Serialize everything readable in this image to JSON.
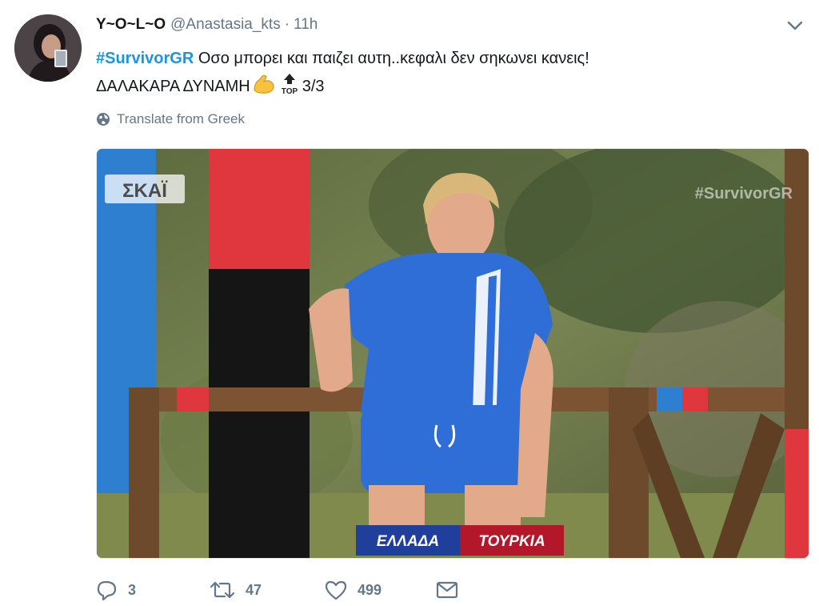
{
  "tweet": {
    "display_name": "Y~O~L~O",
    "handle": "@Anastasia_kts",
    "separator": "·",
    "time": "11h",
    "hashtag": "#SurvivorGR",
    "text_line1": " Οσο μπορει και παιζει αυτη..κεφαλι δεν σηκωνει κανεις!",
    "text_line2": "ΔΑΛΑΚΑΡΑ ΔΥΝΑΜΗ",
    "text_line2_suffix": "3/3",
    "emojis": [
      "flexed-biceps",
      "top-arrow"
    ],
    "top_badge_text": "TOP",
    "translate_label": "Translate from Greek"
  },
  "media": {
    "channel_logo": "ΣΚΑΪ",
    "watermark": "#SurvivorGR",
    "scoreboard_left": "ΕΛΛΑΔΑ",
    "scoreboard_right": "ΤΟΥΡΚΙΑ"
  },
  "actions": {
    "reply_count": "3",
    "retweet_count": "47",
    "like_count": "499"
  },
  "colors": {
    "link_blue": "#1b95e0",
    "muted_gray": "#657786",
    "text_black": "#14171a"
  }
}
